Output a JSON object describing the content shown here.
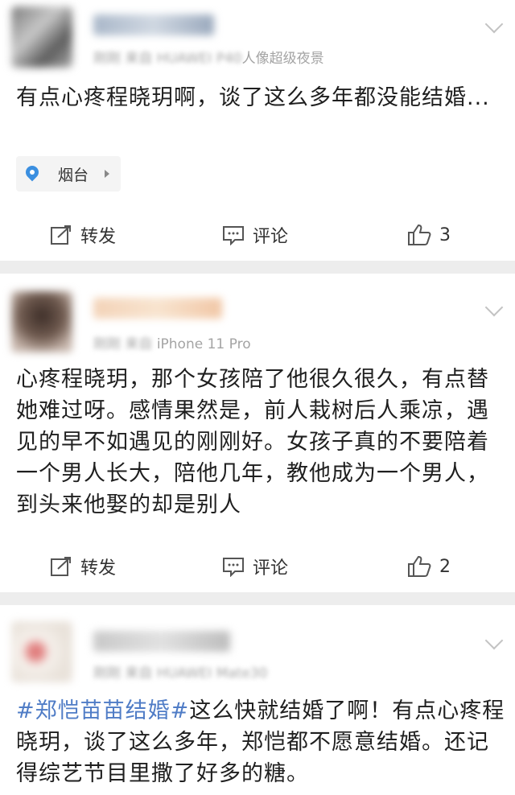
{
  "posts": [
    {
      "meta_visible": "人像超级夜景",
      "text": "有点心疼程晓玥啊，谈了这么多年都没能结婚...",
      "location": "烟台",
      "actions": {
        "repost": "转发",
        "comment": "评论",
        "like_count": "3"
      }
    },
    {
      "meta_visible": "iPhone 11 Pro",
      "text": "心疼程晓玥，那个女孩陪了他很久很久，有点替她难过呀。感情果然是，前人栽树后人乘凉，遇见的早不如遇见的刚刚好。女孩子真的不要陪着一个男人长大，陪他几年，教他成为一个男人，到头来他娶的却是别人",
      "actions": {
        "repost": "转发",
        "comment": "评论",
        "like_count": "2"
      }
    },
    {
      "hashtag": "#郑恺苗苗结婚#",
      "text": "这么快就结婚了啊！有点心疼程晓玥，谈了这么多年，郑恺都不愿意结婚。还记得综艺节目里撒了好多的糖。"
    }
  ],
  "colors": {
    "hashtag": "#4f7cc6",
    "meta_gray": "#a4a4a4",
    "divider": "#ededed"
  }
}
